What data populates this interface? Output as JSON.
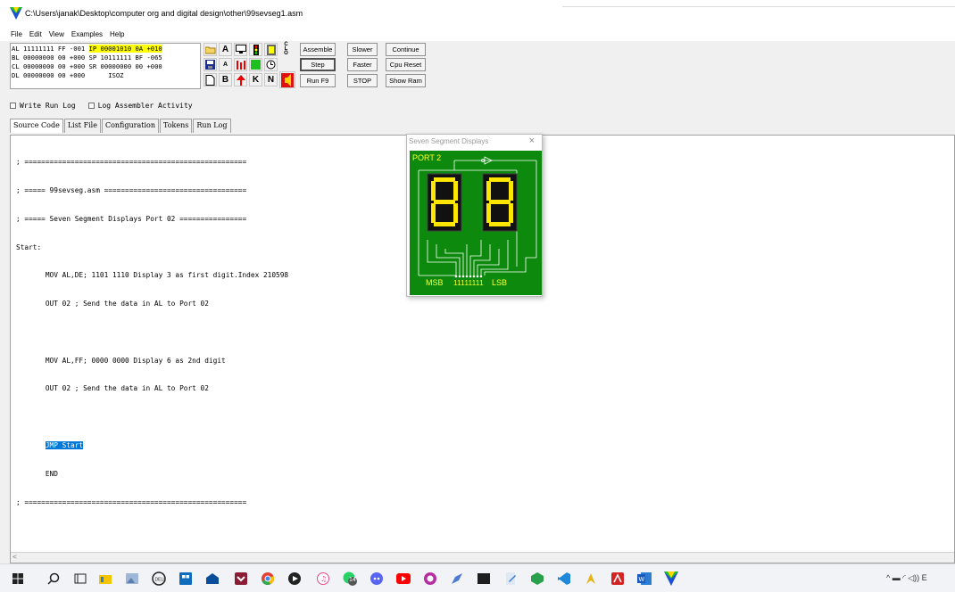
{
  "window": {
    "title": "C:\\Users\\janak\\Desktop\\computer org and digital design\\other\\99sevseg1.asm"
  },
  "menu": [
    "File",
    "Edit",
    "View",
    "Examples",
    "Help"
  ],
  "registers": {
    "row1a": "AL 11111111 FF -001",
    "row1b": "IP 00001010 0A +010",
    "row2": "BL 00000000 00 +000 SP 10111111 BF -065",
    "row3": "CL 00000000 00 +000 SR 00000000 00 +000",
    "row4a": "DL 00000000 00 +000",
    "row4b": "ISOZ"
  },
  "icons": {
    "r1": [
      "open-folder-icon",
      "A",
      "monitor-icon",
      "traffic-light-icon",
      "keypad-icon",
      "CLO"
    ],
    "r2": [
      "save-icon",
      "A",
      "heater-icon",
      "green-square-icon",
      "clock-icon"
    ],
    "r3": [
      "new-file-icon",
      "B",
      "snake-icon",
      "K",
      "N",
      "speaker-icon"
    ],
    "clo_letters": [
      "C",
      "L",
      "O"
    ]
  },
  "buttons": {
    "assemble": "Assemble",
    "step": "Step",
    "run": "Run F9",
    "slower": "Slower",
    "faster": "Faster",
    "stop": "STOP",
    "continue": "Continue",
    "cpu_reset": "Cpu Reset",
    "show_ram": "Show Ram"
  },
  "options": {
    "write_run_log": "Write Run Log",
    "log_assembler": "Log Assembler Activity"
  },
  "tabs": [
    "Source Code",
    "List File",
    "Configuration",
    "Tokens",
    "Run Log"
  ],
  "code": {
    "l1": "; =====================================================",
    "l2": "; ===== 99sevseg.asm ==================================",
    "l3": "; ===== Seven Segment Displays Port 02 ================",
    "l4": "Start:",
    "l5": "       MOV AL,DE; 1101 1110 Display 3 as first digit.Index 210598",
    "l6": "       OUT 02 ; Send the data in AL to Port 02",
    "l7": "",
    "l8": "       MOV AL,FF; 0000 0000 Display 6 as 2nd digit",
    "l9": "       OUT 02 ; Send the data in AL to Port 02",
    "l10": "",
    "l11_sel": "JMP Start",
    "l12": "       END",
    "l13": "; ====================================================="
  },
  "scroll_hint": "<",
  "ssd": {
    "title": "Seven Segment Displays",
    "close": "×",
    "port": "PORT 2",
    "msb": "MSB",
    "lsb": "LSB",
    "bits": "11111111",
    "digit_color": "#ffe600",
    "board_color": "#0d8a0d"
  },
  "taskbar": {
    "icons": [
      "windows-start-icon",
      "search-icon",
      "task-view-icon",
      "file-explorer-icon",
      "photos-icon",
      "dell-icon",
      "store-icon",
      "mail-icon",
      "pocket-icon",
      "chrome-icon",
      "media-icon",
      "itunes-icon",
      "whatsapp-icon",
      "discord-icon",
      "youtube-icon",
      "github-icon",
      "paint-icon",
      "terminal-icon",
      "notepad-icon",
      "cube-icon",
      "vscode-icon",
      "python-icon",
      "acrobat-icon",
      "word-icon",
      "simulator-icon"
    ],
    "whatsapp_badge": "14",
    "tray": "^ ▬ ◜ ◁)) E"
  }
}
